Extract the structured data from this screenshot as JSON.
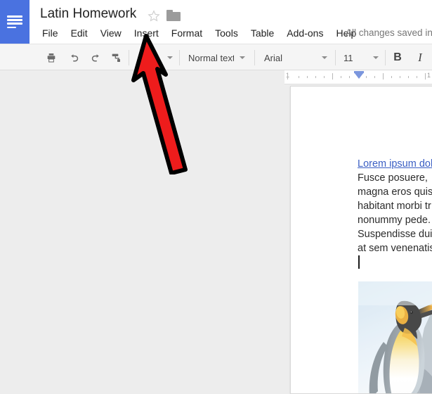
{
  "app": {
    "name": "Google Docs",
    "logo_icon": "docs-lines-icon",
    "accent_color": "#4a72e0",
    "background_color": "#ededed",
    "toolbar_color": "#f5f5f5"
  },
  "header": {
    "title": "Latin Homework",
    "star_icon": "star-outline-icon",
    "folder_icon": "folder-icon",
    "save_status": "All changes saved in"
  },
  "menubar": {
    "items": [
      {
        "label": "File"
      },
      {
        "label": "Edit"
      },
      {
        "label": "View"
      },
      {
        "label": "Insert"
      },
      {
        "label": "Format"
      },
      {
        "label": "Tools"
      },
      {
        "label": "Table"
      },
      {
        "label": "Add-ons"
      },
      {
        "label": "Help"
      }
    ]
  },
  "toolbar": {
    "print_icon": "print-icon",
    "undo_icon": "undo-icon",
    "redo_icon": "redo-icon",
    "paint_format_icon": "paint-format-icon",
    "zoom_value": "",
    "style_value": "Normal text",
    "font_value": "Arial",
    "size_value": "11",
    "bold_label": "B",
    "italic_label": "I",
    "bold_icon": "bold-icon",
    "italic_icon": "italic-icon"
  },
  "ruler": {
    "left_number": "1",
    "mid_number": "1",
    "right_number": "1",
    "indent_marker_icon": "indent-marker-icon"
  },
  "document": {
    "link_text": "Lorem ipsum dol",
    "lines": [
      "Fusce posuere, ",
      "magna eros quis",
      "habitant morbi tr",
      "nonummy pede.",
      "Suspendisse dui",
      "at sem venenatis"
    ],
    "caret_name": "text-cursor",
    "image_alt": "king-penguin-photo"
  },
  "annotation": {
    "arrow_icon": "red-arrow-annotation",
    "arrow_color": "#ee1c1c",
    "arrow_outline_color": "#000000",
    "points_at": "Insert"
  }
}
